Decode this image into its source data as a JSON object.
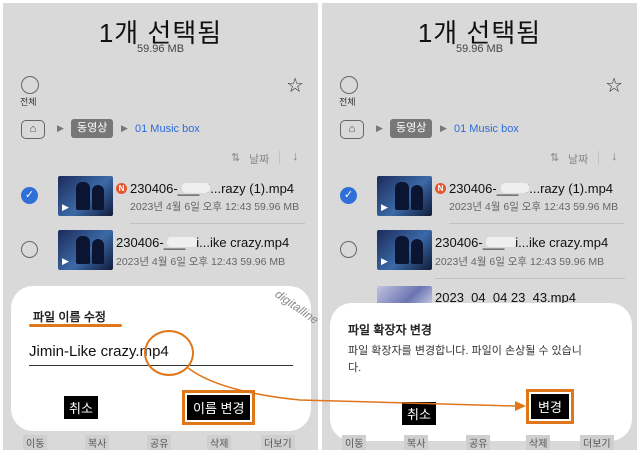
{
  "left": {
    "title": "1개 선택됨",
    "size": "59.96 MB",
    "select_all": "전체",
    "breadcrumb": {
      "folder": "동영상",
      "current": "01 Music box"
    },
    "sort": {
      "label": "날짜"
    },
    "files": [
      {
        "name": "230406-___-J...razy (1).mp4",
        "meta": "2023년 4월 6일 오후 12:43  59.96 MB",
        "checked": true,
        "new": true
      },
      {
        "name": "230406-___-Ji...ike crazy.mp4",
        "meta": "2023년 4월 6일 오후 12:43  59.96 MB",
        "checked": false,
        "new": false
      }
    ],
    "dialog": {
      "title": "파일 이름 수정",
      "input_value": "Jimin-Like crazy.mp4",
      "cancel": "취소",
      "confirm": "이름 변경"
    },
    "bottom_tabs": [
      "이동",
      "복사",
      "공유",
      "삭제",
      "더보기"
    ]
  },
  "right": {
    "title": "1개 선택됨",
    "size": "59.96 MB",
    "select_all": "전체",
    "breadcrumb": {
      "folder": "동영상",
      "current": "01 Music box"
    },
    "sort": {
      "label": "날짜"
    },
    "files": [
      {
        "name": "230406-___-J...razy (1).mp4",
        "meta": "2023년 4월 6일 오후 12:43  59.96 MB",
        "checked": true,
        "new": true
      },
      {
        "name": "230406-___-Ji...ike crazy.mp4",
        "meta": "2023년 4월 6일 오후 12:43  59.96 MB",
        "checked": false,
        "new": false
      },
      {
        "name": "2023_04_04 23_43.mp4",
        "meta": "",
        "checked": false,
        "new": false
      }
    ],
    "dialog": {
      "title": "파일 확장자 변경",
      "message": "파일 확장자를 변경합니다. 파일이 손상될 수 있습니다.",
      "cancel": "취소",
      "confirm": "변경"
    },
    "bottom_tabs": [
      "이동",
      "복사",
      "공유",
      "삭제",
      "더보기"
    ]
  },
  "watermark": "digitalline",
  "colors": {
    "accent": "#2f6fd8",
    "highlight": "#e0761a",
    "dialog_bg": "#ffffff",
    "screen_bg": "#d9d9d9"
  },
  "icons": [
    "star-icon",
    "home-icon",
    "chevron-right-icon",
    "sort-icon",
    "arrow-down-icon",
    "check-icon",
    "play-icon",
    "new-badge-icon"
  ]
}
